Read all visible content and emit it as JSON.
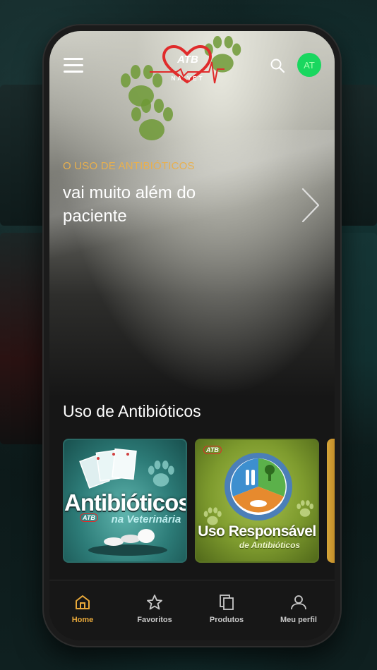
{
  "header": {
    "logo_text": "ATB",
    "logo_subtext": "NA VET",
    "avatar_initials": "AT"
  },
  "hero": {
    "eyebrow": "O USO DE ANTIBIÓTICOS",
    "title": "vai muito além do paciente"
  },
  "section": {
    "title": "Uso de Antibióticos",
    "cards": [
      {
        "title": "Antibióticos",
        "subtitle": "na Veterinária",
        "logo_text": "ATB"
      },
      {
        "title": "Uso Responsável",
        "subtitle": "de Antibióticos",
        "logo_text": "ATB"
      }
    ]
  },
  "bottom_nav": {
    "items": [
      {
        "label": "Home",
        "icon": "home-icon",
        "active": true
      },
      {
        "label": "Favoritos",
        "icon": "star-icon",
        "active": false
      },
      {
        "label": "Produtos",
        "icon": "copy-icon",
        "active": false
      },
      {
        "label": "Meu perfil",
        "icon": "user-icon",
        "active": false
      }
    ]
  },
  "colors": {
    "accent": "#e9b04d",
    "avatar": "#19d75f",
    "logo_red": "#e02b2b",
    "paw_green": "#6f9a36"
  }
}
